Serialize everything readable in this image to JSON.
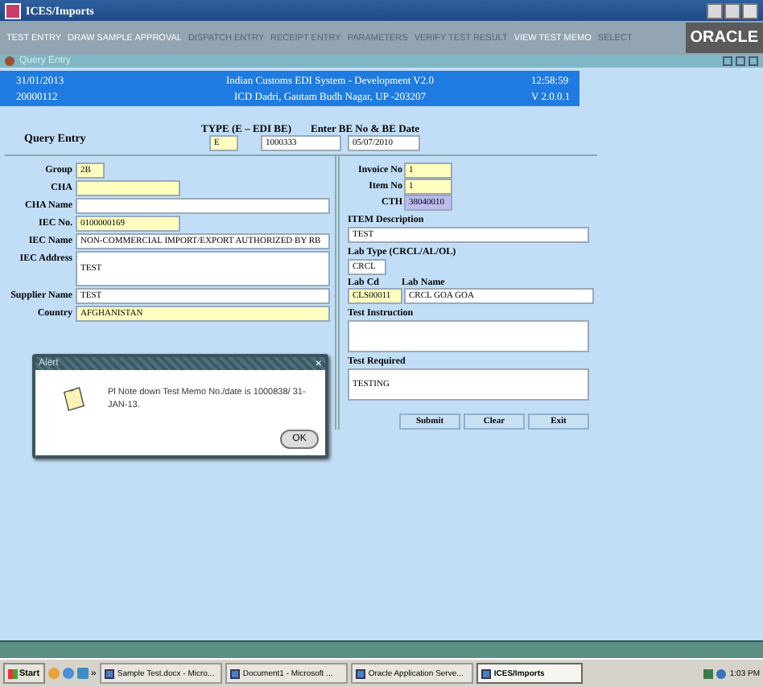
{
  "app": {
    "title": "ICES/Imports"
  },
  "menu": [
    {
      "label": "TEST ENTRY",
      "disabled": false
    },
    {
      "label": "DRAW SAMPLE APPROVAL",
      "disabled": false
    },
    {
      "label": "DISPATCH ENTRY",
      "disabled": true
    },
    {
      "label": "RECEIPT ENTRY",
      "disabled": true
    },
    {
      "label": "PARAMETERS",
      "disabled": true
    },
    {
      "label": "VERIFY TEST RESULT",
      "disabled": true
    },
    {
      "label": "VIEW TEST MEMO",
      "disabled": false
    },
    {
      "label": "SELECT",
      "disabled": true
    }
  ],
  "logo": "ORACLE",
  "form_window": {
    "title": "Query Entry"
  },
  "header": {
    "rows": [
      [
        "31/01/2013",
        "Indian Customs EDI System - Development V2.0",
        "12:58:59"
      ],
      [
        "20000112",
        "ICD Dadri, Gautam Budh Nagar, UP -203207",
        "V 2.0.0.1"
      ]
    ]
  },
  "query": {
    "label": "Query Entry",
    "type_label": "TYPE (E – EDI BE)",
    "be_label": "Enter BE No & BE Date",
    "fields": [
      {
        "value": "E",
        "kind": "required"
      },
      {
        "value": "1000333",
        "kind": "optional"
      },
      {
        "value": "05/07/2010",
        "kind": "optional"
      }
    ]
  },
  "left_fields": [
    {
      "label": "Group",
      "value": "2B",
      "kind": "required"
    },
    {
      "label": "CHA",
      "kind": "required"
    },
    {
      "label": "CHA Name",
      "kind": "optional"
    },
    {
      "label": "IEC No.",
      "value": "0100000169",
      "kind": "required"
    },
    {
      "label": "IEC Name",
      "value": "NON-COMMERCIAL IMPORT/EXPORT AUTHORIZED BY RB",
      "kind": "optional"
    },
    {
      "label": "IEC Address",
      "value": "TEST",
      "kind": "optional"
    },
    {
      "label": "Supplier Name",
      "value": "TEST",
      "kind": "optional"
    },
    {
      "label": "Country",
      "value": "AFGHANISTAN",
      "kind": "required"
    }
  ],
  "invoice_fields": [
    {
      "label": "Invoice No",
      "value": "1",
      "kind": "required"
    },
    {
      "label": "Item No",
      "value": "1",
      "kind": "required"
    },
    {
      "label": "CTH",
      "value": "38040010",
      "kind": "display"
    }
  ],
  "item_fields": [
    {
      "label": "ITEM Description",
      "value": "TEST",
      "kind": "optional"
    },
    {
      "label": "Lab Type (CRCL/AL/OL)",
      "value": "CRCL",
      "kind": "optional"
    }
  ],
  "lab": {
    "code_label": "Lab Cd",
    "name_label": "Lab Name",
    "code": {
      "value": "CLS00011",
      "kind": "required"
    },
    "name": {
      "value": "CRCL GOA GOA",
      "kind": "optional"
    }
  },
  "text_fields": [
    {
      "label": "Test Instruction",
      "kind": "optional"
    },
    {
      "label": "Test Required",
      "value": "TESTING",
      "kind": "optional"
    }
  ],
  "buttons": [
    "Submit",
    "Clear",
    "Exit"
  ],
  "alert": {
    "title": "Alert",
    "close": "×",
    "message": "Pl Note down Test Memo No./date is 1000838/ 31-JAN-13.",
    "button": "OK"
  },
  "taskbar": {
    "start": "Start",
    "more": "»",
    "items": [
      {
        "label": "Sample Test.docx - Micro...",
        "selected": false
      },
      {
        "label": "Document1 - Microsoft ...",
        "selected": false
      },
      {
        "label": "Oracle Application Serve...",
        "selected": false
      },
      {
        "label": "ICES/Imports",
        "selected": true
      }
    ],
    "clock": "1:03 PM"
  }
}
